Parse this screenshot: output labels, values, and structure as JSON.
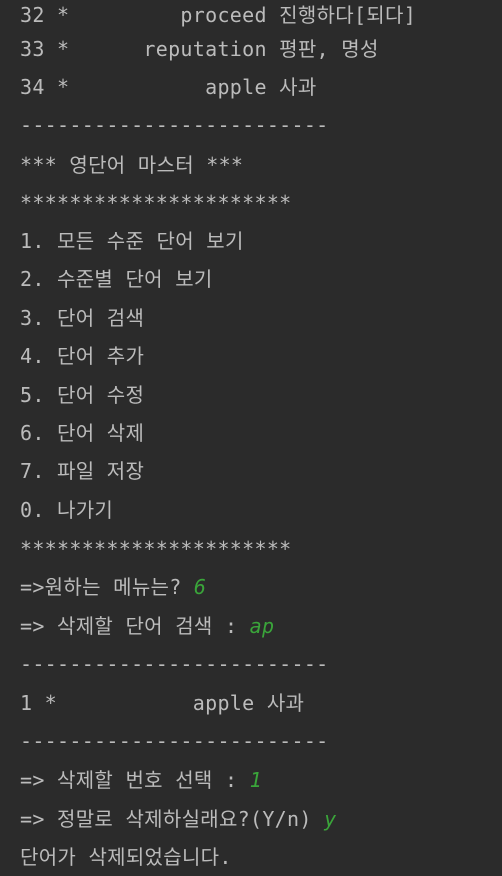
{
  "console": {
    "lines": [
      {
        "text": "32 *         proceed 진행하다[되다]"
      },
      {
        "text": "33 *      reputation 평판, 명성"
      },
      {
        "text": "34 *           apple 사과"
      },
      {
        "text": "-------------------------"
      },
      {
        "text": "*** 영단어 마스터 ***"
      },
      {
        "text": "**********************"
      },
      {
        "text": "1. 모든 수준 단어 보기"
      },
      {
        "text": "2. 수준별 단어 보기"
      },
      {
        "text": "3. 단어 검색"
      },
      {
        "text": "4. 단어 추가"
      },
      {
        "text": "5. 단어 수정"
      },
      {
        "text": "6. 단어 삭제"
      },
      {
        "text": "7. 파일 저장"
      },
      {
        "text": "0. 나가기"
      },
      {
        "text": "**********************"
      },
      {
        "text": "=>원하는 메뉴는? ",
        "input": "6"
      },
      {
        "text": "=> 삭제할 단어 검색 : ",
        "input": "ap"
      },
      {
        "text": "-------------------------"
      },
      {
        "text": "1 *           apple 사과"
      },
      {
        "text": "-------------------------"
      },
      {
        "text": "=> 삭제할 번호 선택 : ",
        "input": "1"
      },
      {
        "text": "=> 정말로 삭제하실래요?(Y/n) ",
        "input": "y"
      },
      {
        "text": "단어가 삭제되었습니다."
      }
    ]
  }
}
